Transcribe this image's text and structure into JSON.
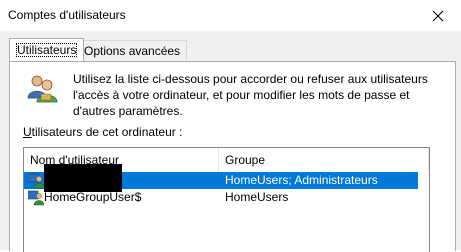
{
  "window": {
    "title": "Comptes d'utilisateurs",
    "close_icon": "close-icon"
  },
  "tabs": [
    {
      "label": "Utilisateurs",
      "active": true
    },
    {
      "label": "Options avancées",
      "active": false
    }
  ],
  "description": "Utilisez la liste ci-dessous pour accorder ou refuser aux utilisateurs l'accès à votre ordinateur, et pour modifier les mots de passe et d'autres paramètres.",
  "section_label": {
    "accel": "U",
    "rest": "tilisateurs de cet ordinateur :"
  },
  "list": {
    "columns": [
      "Nom d'utilisateur",
      "Groupe"
    ],
    "rows": [
      {
        "name": "",
        "group": "HomeUsers; Administrateurs",
        "selected": true
      },
      {
        "name": "HomeGroupUser$",
        "group": "HomeUsers",
        "selected": false
      }
    ]
  },
  "colors": {
    "selection": "#0078d7",
    "panel_border": "#adadad"
  }
}
